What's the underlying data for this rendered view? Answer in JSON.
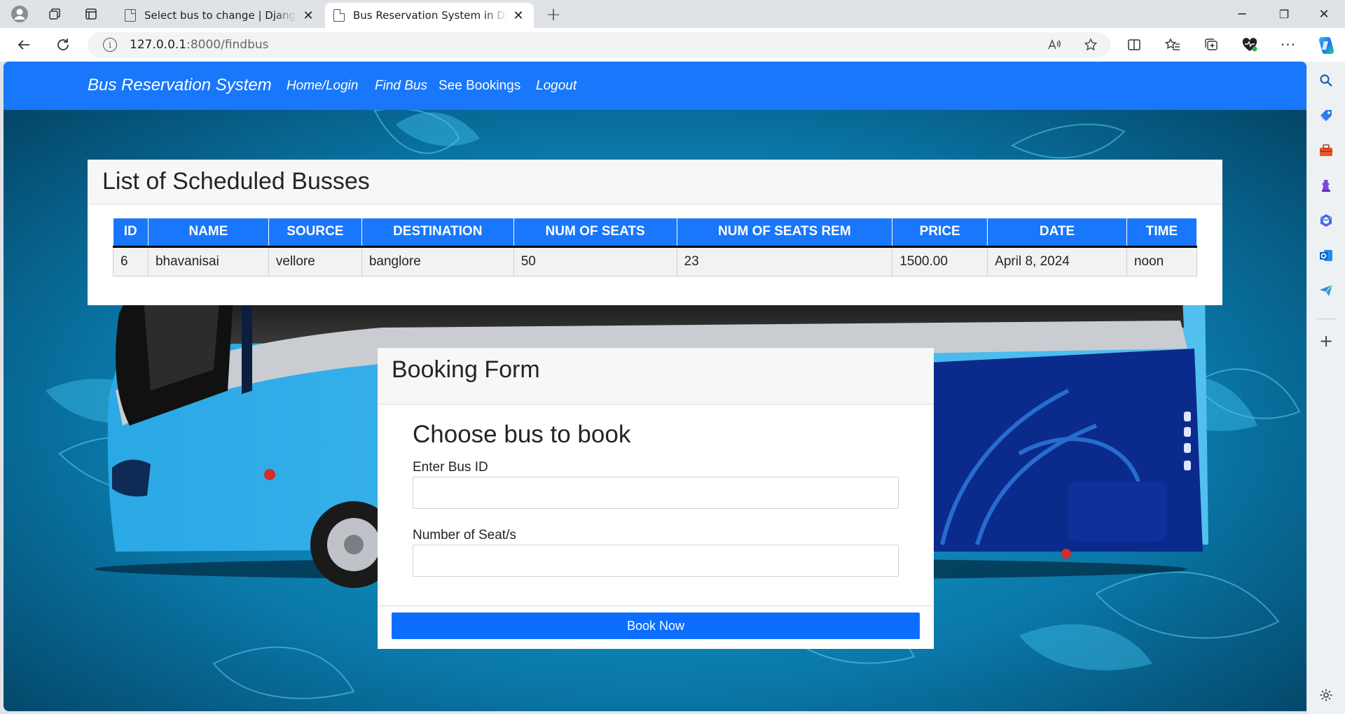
{
  "browser": {
    "tabs": [
      {
        "title": "Select bus to change | Django site admin",
        "active": false
      },
      {
        "title": "Bus Reservation System in Django",
        "active": true
      }
    ],
    "url_host": "127.0.0.1",
    "url_rest": ":8000/findbus",
    "window_controls": {
      "minimize": "─",
      "restore": "❐",
      "close": "✕"
    }
  },
  "navbar": {
    "brand": "Bus Reservation System",
    "links": [
      "Home/Login",
      "Find Bus",
      "See Bookings",
      "Logout"
    ]
  },
  "bus_list": {
    "title": "List of Scheduled Busses",
    "columns": [
      "ID",
      "NAME",
      "SOURCE",
      "DESTINATION",
      "NUM OF SEATS",
      "NUM OF SEATS REM",
      "PRICE",
      "DATE",
      "TIME"
    ],
    "rows": [
      [
        "6",
        "bhavanisai",
        "vellore",
        "banglore",
        "50",
        "23",
        "1500.00",
        "April 8, 2024",
        "noon"
      ]
    ]
  },
  "booking_form": {
    "header": "Booking Form",
    "heading": "Choose bus to book",
    "bus_id_label": "Enter Bus ID",
    "bus_id_value": "",
    "seats_label": "Number of Seat/s",
    "seats_value": "",
    "submit_label": "Book Now"
  },
  "colors": {
    "navbar": "#1877fb",
    "button": "#0d6efd",
    "table_header": "#1877fb"
  }
}
